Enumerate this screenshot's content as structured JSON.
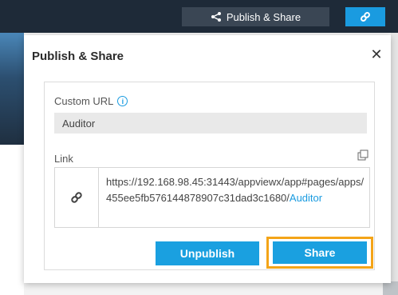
{
  "topbar": {
    "publish_label": "Publish & Share",
    "publish_icon": "share-icon",
    "link_icon": "link-icon"
  },
  "dialog": {
    "title": "Publish & Share",
    "close_icon": "close-icon",
    "custom_url": {
      "label": "Custom URL",
      "info_icon": "info-icon",
      "value": "Auditor"
    },
    "link": {
      "label": "Link",
      "copy_icon": "copy-icon",
      "link_icon": "link-icon",
      "url_base": "https://192.168.98.45:31443/appviewx/app#pages/apps/455ee5fb576144878907c31dad3c1680/",
      "url_highlight": "Auditor"
    },
    "buttons": {
      "unpublish": "Unpublish",
      "share": "Share"
    }
  },
  "colors": {
    "accent": "#1aa0e0",
    "highlight_border": "#f4a418",
    "topbar": "#1e2a38"
  }
}
